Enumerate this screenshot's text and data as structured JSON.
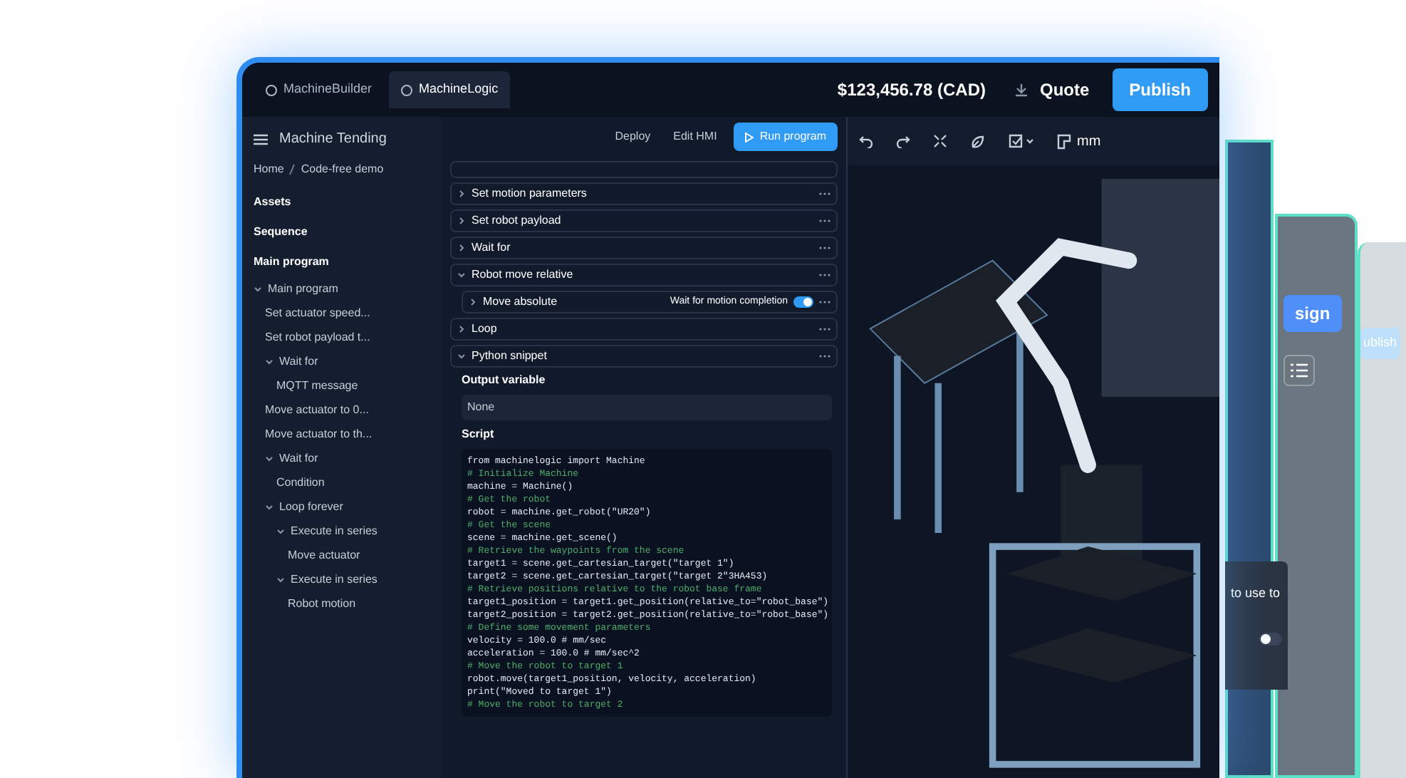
{
  "tabs": [
    {
      "label": "MachineBuilder",
      "selected": false
    },
    {
      "label": "MachineLogic",
      "selected": true
    }
  ],
  "top_bar": {
    "price": "$123,456.78 (CAD)",
    "quote": "Quote",
    "publish": "Publish"
  },
  "toolbar": {
    "units": "mm"
  },
  "sidebar": {
    "title": "Machine Tending",
    "breadcrumb": [
      "Home",
      "Code-free demo"
    ],
    "sections": [
      "Assets",
      "Sequence",
      "Main program"
    ],
    "tree": [
      {
        "label": "Main program",
        "expanded": true,
        "children": [
          {
            "label": "Set actuator speed..."
          },
          {
            "label": "Set robot payload t..."
          },
          {
            "label": "Wait for",
            "expanded": true,
            "children": [
              {
                "label": "MQTT message"
              }
            ]
          },
          {
            "label": "Move actuator to 0..."
          },
          {
            "label": "Move actuator to th..."
          },
          {
            "label": "Wait for",
            "expanded": true,
            "children": [
              {
                "label": "Condition"
              }
            ]
          },
          {
            "label": "Loop forever",
            "expanded": true,
            "children": [
              {
                "label": "Execute in series",
                "expanded": true,
                "children": [
                  {
                    "label": "Move actuator"
                  }
                ]
              },
              {
                "label": "Execute in series",
                "expanded": true,
                "children": [
                  {
                    "label": "Robot motion"
                  }
                ]
              }
            ]
          }
        ]
      }
    ]
  },
  "program": {
    "actions": [
      "Deploy",
      "Edit HMI",
      "Run program"
    ],
    "blocks": [
      {
        "label": "Set motion parameters",
        "expanded": false,
        "indent": false
      },
      {
        "label": "Set robot payload",
        "expanded": false,
        "indent": false
      },
      {
        "label": "Wait for",
        "expanded": false,
        "indent": false
      },
      {
        "label": "Robot move relative",
        "expanded": true,
        "indent": false
      },
      {
        "label": "Move absolute",
        "expanded": false,
        "indent": true,
        "option": {
          "label": "Wait for motion completion",
          "on": true
        }
      },
      {
        "label": "Loop",
        "expanded": false,
        "indent": false
      },
      {
        "label": "Python snippet",
        "expanded": true,
        "indent": false
      }
    ],
    "output_label": "Output variable",
    "output_value": "None",
    "script_label": "Script",
    "script": [
      {
        "kind": "code",
        "text": "from machinelogic import Machine"
      },
      {
        "kind": "comment",
        "text": "# Initialize Machine"
      },
      {
        "kind": "code",
        "text": "machine = Machine()"
      },
      {
        "kind": "comment",
        "text": "# Get the robot"
      },
      {
        "kind": "code",
        "text": "robot = machine.get_robot(\"UR20\")"
      },
      {
        "kind": "comment",
        "text": "# Get the scene"
      },
      {
        "kind": "code",
        "text": "scene = machine.get_scene()"
      },
      {
        "kind": "comment",
        "text": "# Retrieve the waypoints from the scene"
      },
      {
        "kind": "code",
        "text": "target1 = scene.get_cartesian_target(\"target 1\")"
      },
      {
        "kind": "code",
        "text": "target2 = scene.get_cartesian_target(\"target 2\"3HA453)"
      },
      {
        "kind": "comment",
        "text": "# Retrieve positions relative to the robot base frame"
      },
      {
        "kind": "code",
        "text": "target1_position = target1.get_position(relative_to=\"robot_base\")"
      },
      {
        "kind": "code",
        "text": "target2_position = target2.get_position(relative_to=\"robot_base\")"
      },
      {
        "kind": "comment",
        "text": "# Define some movement parameters"
      },
      {
        "kind": "code",
        "text": "velocity = 100.0  # mm/sec"
      },
      {
        "kind": "code",
        "text": "acceleration = 100.0  # mm/sec^2"
      },
      {
        "kind": "comment",
        "text": "# Move the robot to target 1"
      },
      {
        "kind": "code",
        "text": "robot.move(target1_position, velocity, acceleration)"
      },
      {
        "kind": "code",
        "text": "print(\"Moved to target 1\")"
      },
      {
        "kind": "comment",
        "text": "# Move the robot to target 2"
      }
    ]
  },
  "back_panels": {
    "design_button": "sign",
    "publish_button": "ublish",
    "card_text": "to use to",
    "card_toggle_on": false
  }
}
